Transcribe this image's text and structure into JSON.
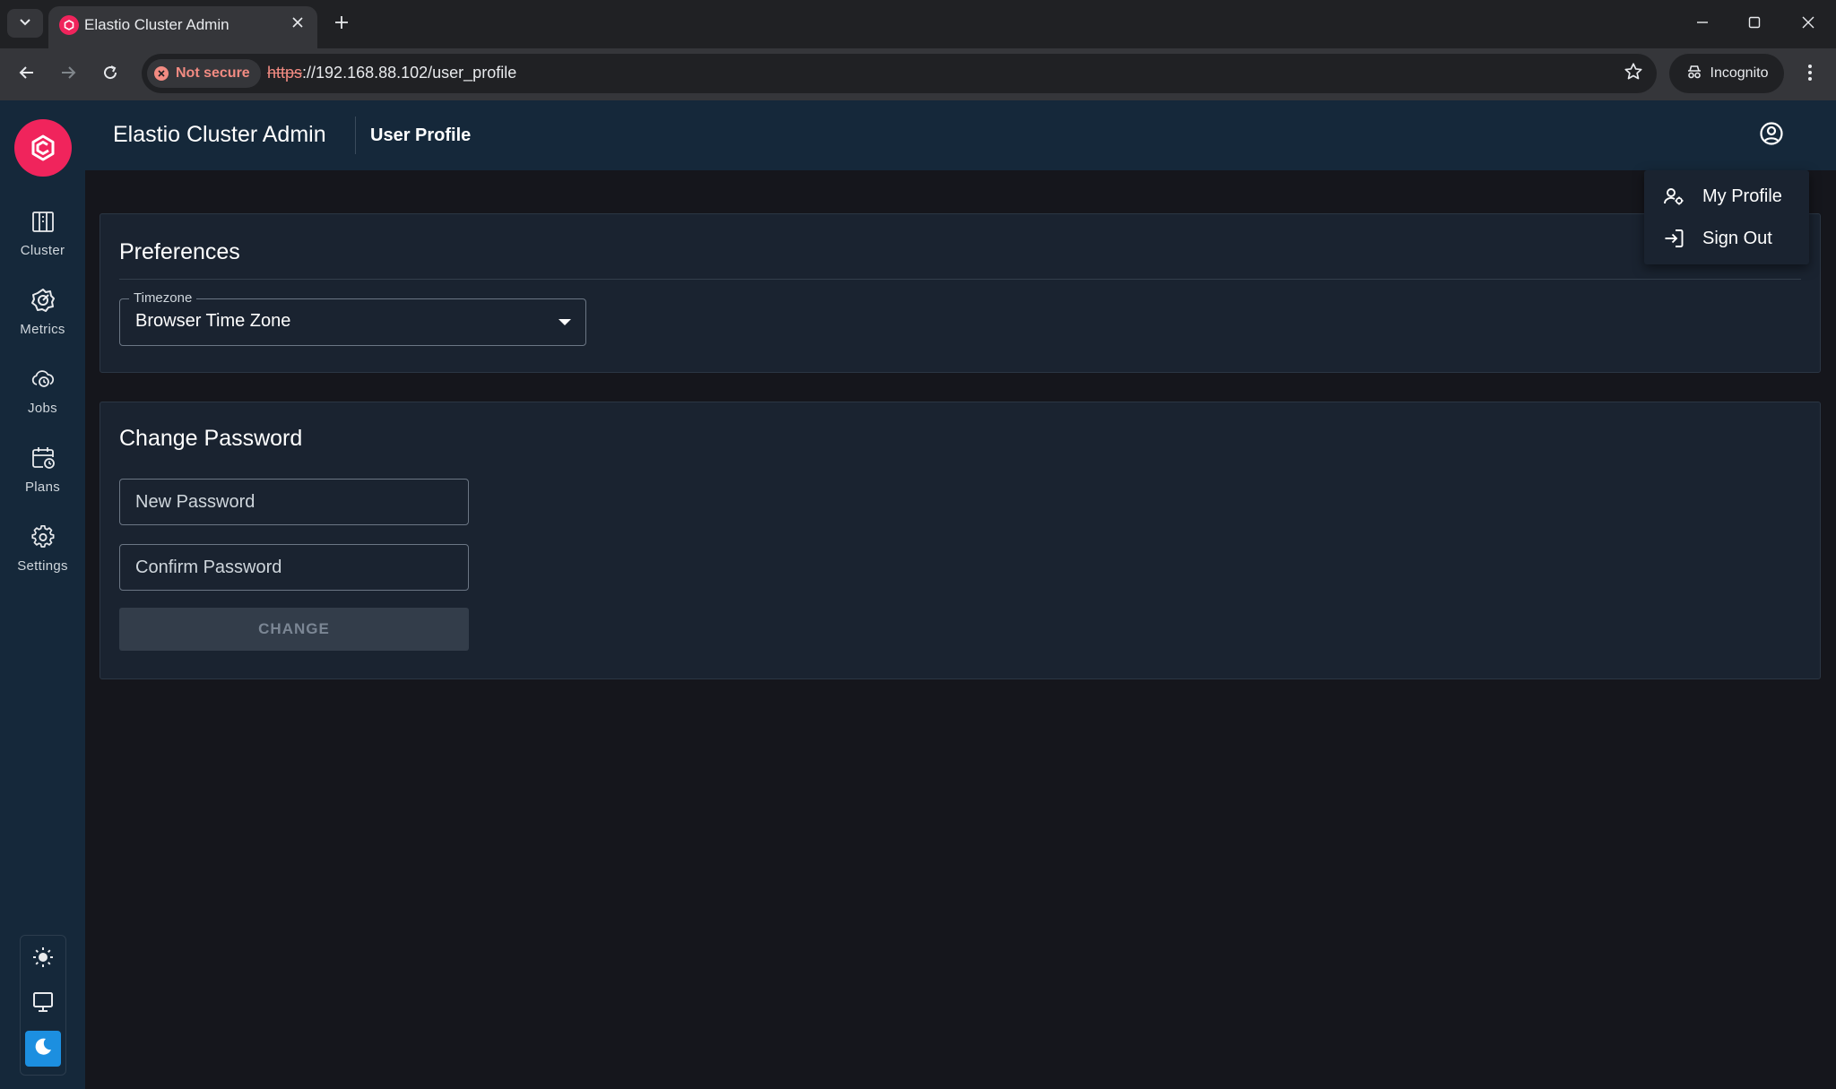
{
  "browser": {
    "tab_title": "Elastio Cluster Admin",
    "security_label": "Not secure",
    "url_scheme": "https",
    "url_rest": "://192.168.88.102/user_profile",
    "incognito_label": "Incognito"
  },
  "app": {
    "title": "Elastio Cluster Admin",
    "page_title": "User Profile"
  },
  "sidebar": {
    "items": [
      {
        "label": "Cluster",
        "icon": "cluster-icon"
      },
      {
        "label": "Metrics",
        "icon": "metrics-icon"
      },
      {
        "label": "Jobs",
        "icon": "jobs-icon"
      },
      {
        "label": "Plans",
        "icon": "plans-icon"
      },
      {
        "label": "Settings",
        "icon": "gear-icon"
      }
    ],
    "theme_modes": [
      "light",
      "system",
      "dark"
    ],
    "active_theme": "dark"
  },
  "preferences": {
    "title": "Preferences",
    "timezone_label": "Timezone",
    "timezone_value": "Browser Time Zone"
  },
  "change_password": {
    "title": "Change Password",
    "new_placeholder": "New Password",
    "confirm_placeholder": "Confirm Password",
    "button_label": "CHANGE"
  },
  "account_menu": {
    "items": [
      {
        "label": "My Profile",
        "icon": "profile-icon"
      },
      {
        "label": "Sign Out",
        "icon": "sign-out-icon"
      }
    ]
  },
  "colors": {
    "brand": "#f0245c",
    "sidebar_bg": "#15283a",
    "page_bg": "#15161c",
    "card_bg": "#1a2330",
    "active_theme": "#1c8fe0"
  }
}
